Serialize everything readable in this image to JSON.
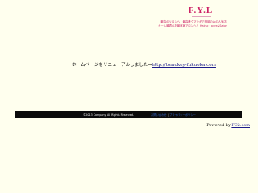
{
  "header": {
    "logo": "F.Y.L",
    "tagline_line1": "「最高のリロンへ」最高峰クマシギで福岡のみの人気店",
    "tagline_line2": "カール最適のお最良客アロンへ！ Hairsc・pure&Salon"
  },
  "main": {
    "notice_text": "ホームページをリニューアルしました→",
    "notice_link": "http://tomokey-fukuoka.com"
  },
  "footer": {
    "copyright": "©2013 Company. All Rights Reserved.",
    "link_1": "お問い合わせ",
    "separator": "|",
    "link_2": "プライバシーポリシー"
  },
  "powered": {
    "label": "Powered by ",
    "link": "FC2.com"
  },
  "colors": {
    "background": "#ffffee",
    "accent": "#cc2266",
    "footer_bar": "#0b0b0b",
    "link": "#1a1a8a"
  }
}
